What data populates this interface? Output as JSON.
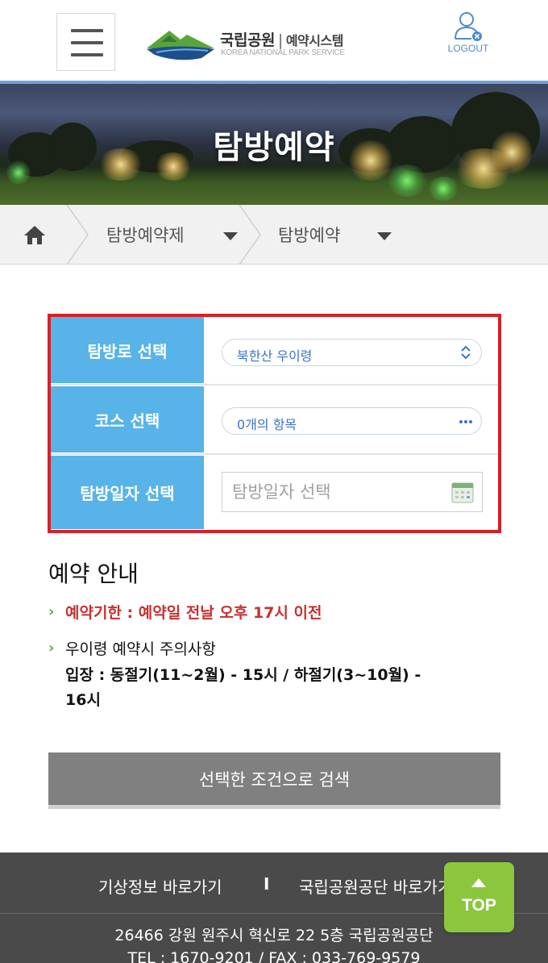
{
  "header": {
    "logo": {
      "name": "국립공원",
      "separator": "|",
      "system": "예약시스템",
      "sub": "KOREA NATIONAL PARK SERVICE"
    },
    "logout_label": "LOGOUT",
    "menu_icon": "hamburger-icon"
  },
  "banner": {
    "title": "탐방예약"
  },
  "breadcrumb": {
    "home_icon": "home-icon",
    "items": [
      {
        "label": "탐방예약제"
      },
      {
        "label": "탐방예약"
      }
    ]
  },
  "form": {
    "rows": [
      {
        "label": "탐방로 선택",
        "value": "북한산 우이령",
        "arrow": "⌃⌄"
      },
      {
        "label": "코스 선택",
        "value": "0개의 항목",
        "arrow": "···"
      },
      {
        "label": "탐방일자 선택",
        "placeholder": "탐방일자 선택"
      }
    ],
    "border_color": "#d62127",
    "label_color": "#58b3e9"
  },
  "info": {
    "title": "예약 안내",
    "deadline": "예약기한 : 예약일 전날 오후 17시 이전",
    "notice_title": "우이령 예약시 주의사항",
    "notice_line1": "입장 : 동절기(11~2월) - 15시 / 하절기(3~10월) -",
    "notice_line2": "16시"
  },
  "search_button": "선택한 조건으로 검색",
  "footer": {
    "link_weather": "기상정보 바로가기",
    "divider": "I",
    "link_knps": "국립공원공단 바로가기",
    "address": "26466 강원 원주시 혁신로 22 5층 국립공원공단",
    "tel": "TEL : 1670-9201 / FAX : 033-769-9579"
  },
  "top_button": "TOP"
}
